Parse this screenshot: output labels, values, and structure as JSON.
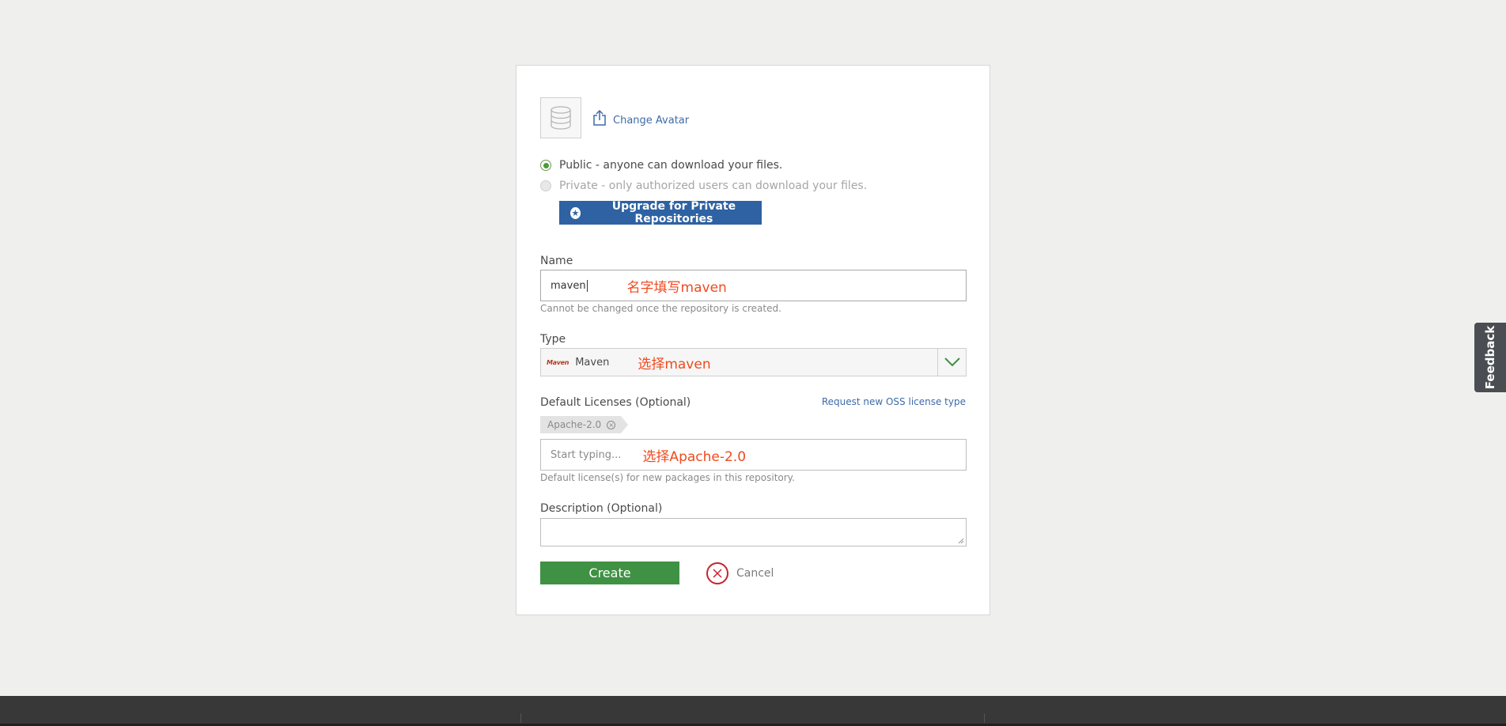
{
  "avatar": {
    "change_label": "Change Avatar"
  },
  "visibility": {
    "public_label": "Public - anyone can download your files.",
    "private_label": "Private - only authorized users can download your files.",
    "selected": "public",
    "upgrade_label": "Upgrade for Private Repositories"
  },
  "name": {
    "label": "Name",
    "value": "maven",
    "annotation": "名字填写maven",
    "hint": "Cannot be changed once the repository is created."
  },
  "type": {
    "label": "Type",
    "logo_text": "Maven",
    "value": "Maven",
    "annotation": "选择maven"
  },
  "licenses": {
    "label": "Default Licenses (Optional)",
    "request_link": "Request new OSS license type",
    "tags": [
      "Apache-2.0"
    ],
    "placeholder": "Start typing...",
    "annotation": "选择Apache-2.0",
    "hint": "Default license(s) for new packages in this repository."
  },
  "description": {
    "label": "Description (Optional)",
    "value": ""
  },
  "actions": {
    "create_label": "Create",
    "cancel_label": "Cancel"
  },
  "feedback": {
    "label": "Feedback"
  },
  "colors": {
    "primary_blue": "#2e62a3",
    "create_green": "#3f9143",
    "cancel_red": "#c8232b",
    "annotation_red": "#ef4a1f",
    "link_blue": "#3d6ba8"
  }
}
